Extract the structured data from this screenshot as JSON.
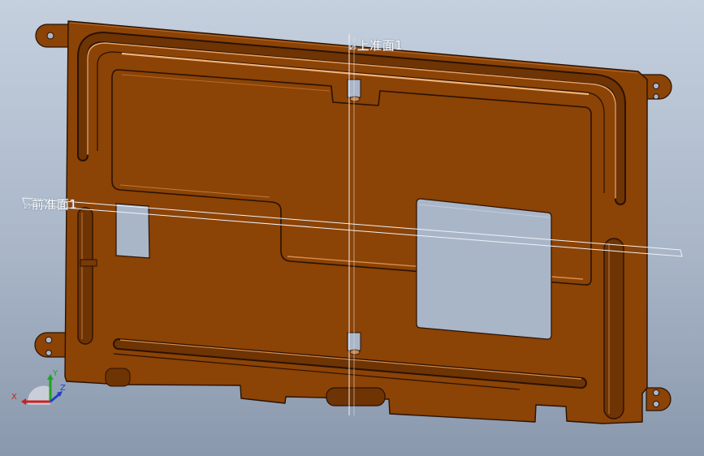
{
  "viewport": {
    "background_top": "#c4d0de",
    "background_bottom": "#8a98ad"
  },
  "part": {
    "color": "#8b4306",
    "edge_color": "#2a1202",
    "highlight_color": "#e8a36a"
  },
  "planes": {
    "top_label": "上准面1",
    "top_icon": "datum-plane-icon",
    "front_label": "前准面1",
    "front_icon": "datum-plane-icon"
  },
  "triad": {
    "x_label": "X",
    "y_label": "Y",
    "z_label": "Z",
    "x_color": "#cc1f1f",
    "y_color": "#1fa31f",
    "z_color": "#1f3fcc"
  }
}
